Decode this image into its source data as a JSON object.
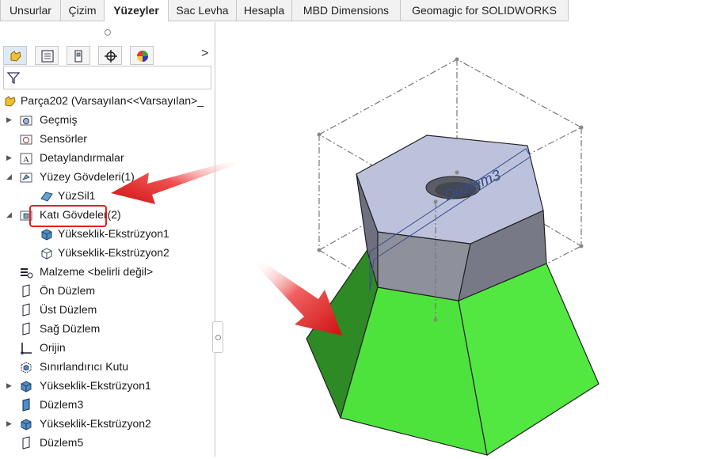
{
  "tabs": [
    {
      "label": "Unsurlar",
      "active": false
    },
    {
      "label": "Çizim",
      "active": false
    },
    {
      "label": "Yüzeyler",
      "active": true
    },
    {
      "label": "Sac Levha",
      "active": false
    },
    {
      "label": "Hesapla",
      "active": false
    },
    {
      "label": "MBD Dimensions",
      "active": false
    },
    {
      "label": "Geomagic for SOLIDWORKS",
      "active": false
    }
  ],
  "feature_manager": {
    "tab_icons": [
      "feature-manager-tab-icon",
      "property-manager-tab-icon",
      "configuration-manager-tab-icon",
      "dimxpert-tab-icon",
      "display-manager-tab-icon"
    ],
    "expand_arrow": ">",
    "root_label": "Parça202  (Varsayılan<<Varsayılan>_",
    "tree": [
      {
        "label": "Geçmiş",
        "icon": "history-folder-icon"
      },
      {
        "label": "Sensörler",
        "icon": "sensor-icon"
      },
      {
        "label": "Detaylandırmalar",
        "icon": "annotations-icon"
      },
      {
        "label": "Yüzey Gövdeleri(1)",
        "icon": "surface-bodies-folder-icon"
      },
      {
        "label": "YüzSil1",
        "icon": "surface-delete-icon"
      },
      {
        "label": "Katı Gövdeler(2)",
        "icon": "solid-bodies-folder-icon"
      },
      {
        "label": "Yükseklik-Ekstrüzyon1",
        "icon": "solid-body-icon"
      },
      {
        "label": "Yükseklik-Ekstrüzyon2",
        "icon": "solid-body-outline-icon"
      },
      {
        "label": "Malzeme <belirli değil>",
        "icon": "material-icon"
      },
      {
        "label": "Ön Düzlem",
        "icon": "plane-icon"
      },
      {
        "label": "Üst Düzlem",
        "icon": "plane-icon"
      },
      {
        "label": "Sağ Düzlem",
        "icon": "plane-icon"
      },
      {
        "label": "Orijin",
        "icon": "origin-icon"
      },
      {
        "label": "Sınırlandırıcı Kutu",
        "icon": "bounding-box-icon"
      },
      {
        "label": "Yükseklik-Ekstrüzyon1",
        "icon": "extrude-feature-icon"
      },
      {
        "label": "Düzlem3",
        "icon": "plane-icon"
      },
      {
        "label": "Yükseklik-Ekstrüzyon2",
        "icon": "extrude-feature-icon"
      },
      {
        "label": "Düzlem5",
        "icon": "plane-icon"
      }
    ]
  },
  "viewport": {
    "plane_label": "Düzlem3",
    "colors": {
      "green": "#4de33c",
      "green_dark": "#2e8a24",
      "hex_top": "#bcc2dc",
      "hex_side": "#7d7f8a",
      "arrow": "#e21b1b"
    }
  }
}
